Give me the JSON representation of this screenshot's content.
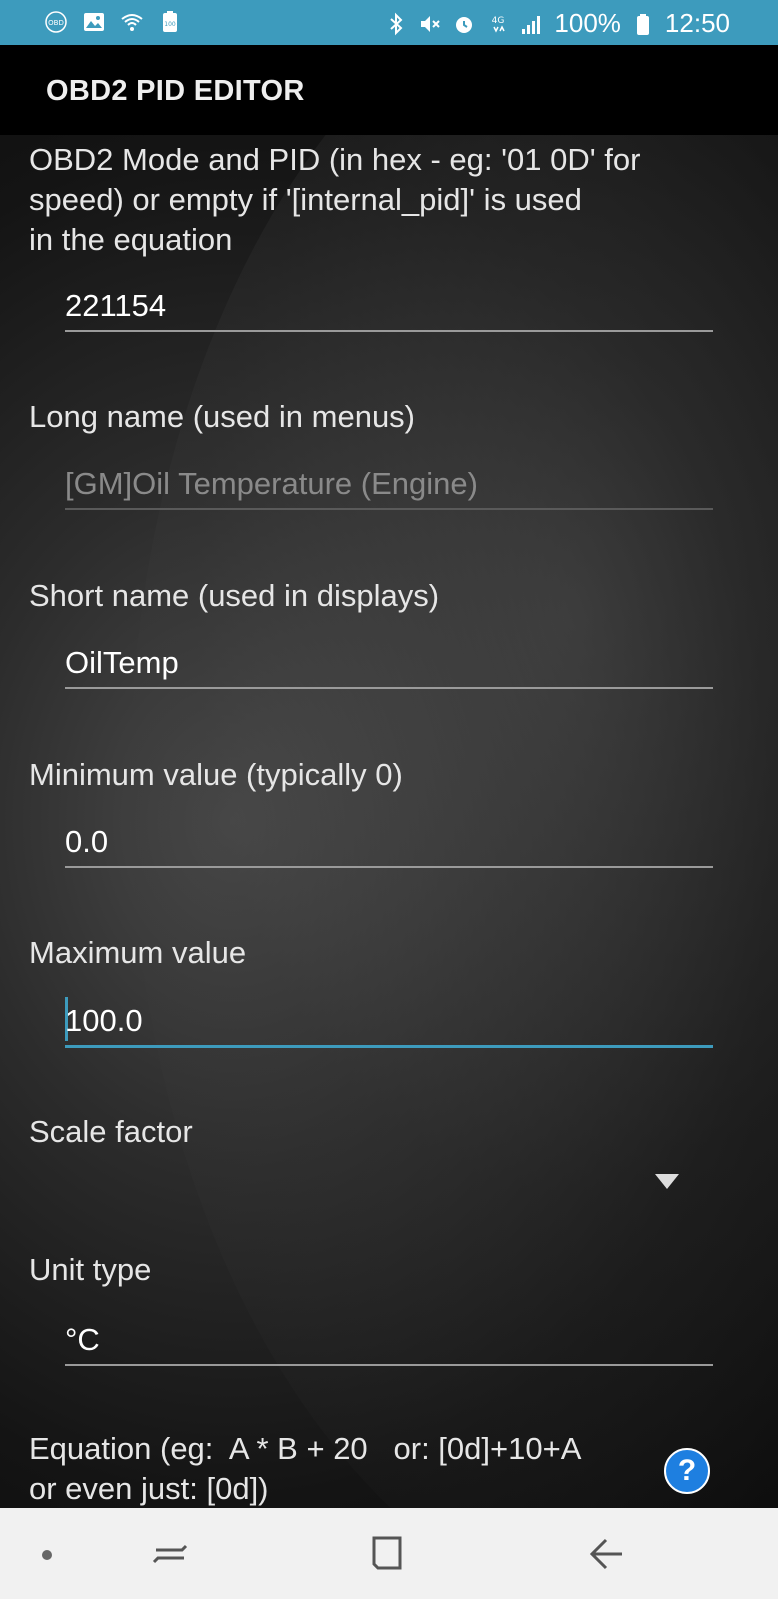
{
  "status_bar": {
    "battery_percent": "100%",
    "time": "12:50",
    "left_icons": [
      "obd-icon",
      "image-icon",
      "wifi-question-icon",
      "battery-100-icon"
    ],
    "right_icons": [
      "bluetooth-icon",
      "mute-icon",
      "alarm-icon",
      "data-4g-icon",
      "signal-icon",
      "battery-icon"
    ]
  },
  "header": {
    "title": "OBD2 PID EDITOR"
  },
  "form": {
    "pid": {
      "label_line1": "OBD2 Mode and PID (in hex - eg: '01 0D' for",
      "label_line2": "speed) or empty if '[internal_pid]' is used",
      "label_line3": "in the equation",
      "value": "221154"
    },
    "long_name": {
      "label": "Long name (used in menus)",
      "value": "[GM]Oil Temperature (Engine)"
    },
    "short_name": {
      "label": "Short name (used in displays)",
      "value": "OilTemp"
    },
    "min_value": {
      "label": "Minimum value (typically 0)",
      "value": "0.0"
    },
    "max_value": {
      "label": "Maximum value",
      "value": "100.0"
    },
    "scale_factor": {
      "label": "Scale factor",
      "value": ""
    },
    "unit_type": {
      "label": "Unit type",
      "value": "°C"
    },
    "equation": {
      "label_line1": "Equation (eg:  A * B + 20   or: [0d]+10+A",
      "label_line2": "or even just: [0d])"
    }
  },
  "help_button": {
    "label": "?"
  },
  "colors": {
    "status_bar": "#3d9bbd",
    "accent": "#3d9bbd",
    "help_button": "#1e7fe0"
  }
}
